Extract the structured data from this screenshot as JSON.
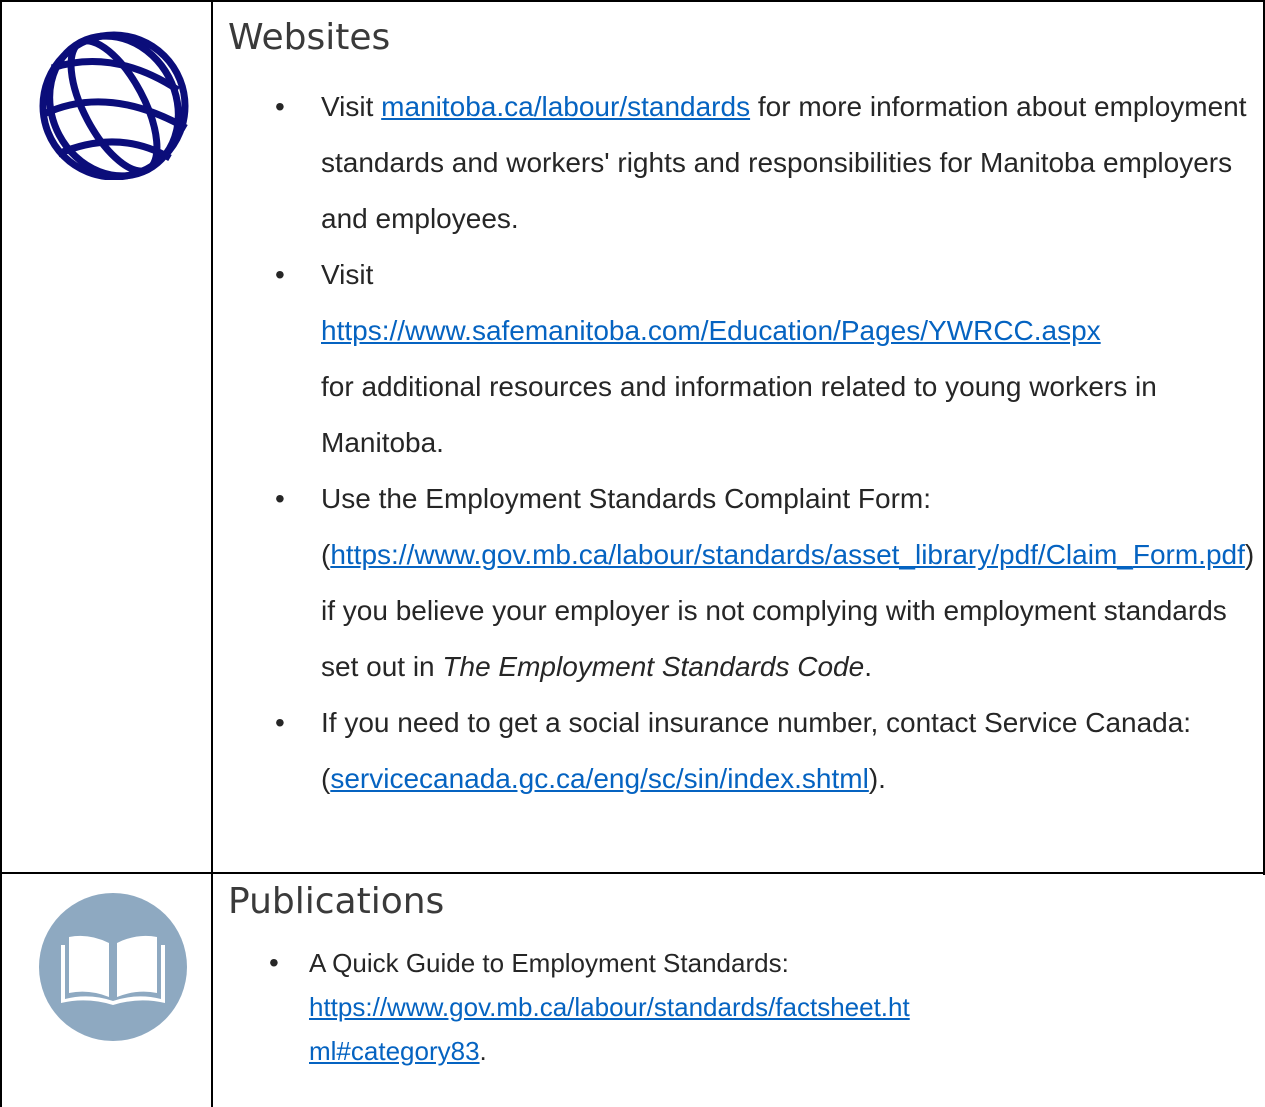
{
  "websites": {
    "title": "Websites",
    "icon": "globe-icon",
    "item1": {
      "pre": "Visit ",
      "link": "manitoba.ca/labour/standards",
      "post": " for more information about employment standards and workers' rights and responsibilities for Manitoba employers and employees."
    },
    "item2": {
      "pre": "Visit",
      "link": "https://www.safemanitoba.com/Education/Pages/YWRCC.aspx",
      "post": "for additional resources and information related to young workers in Manitoba."
    },
    "item3": {
      "pre": "Use the Employment Standards Complaint Form: (",
      "link_part1": "https://www.gov.mb.ca/labour/standards/asset_library/pdf/Claim_",
      "link_part2": "Form.pdf",
      "mid": ") if you believe your employer is not complying with employment standards set out in ",
      "italic": "The Employment Standards Code",
      "post": "."
    },
    "item4": {
      "pre": "If you need to get a social insurance number, contact Service Canada: (",
      "link": "servicecanada.gc.ca/eng/sc/sin/index.shtml",
      "post": ")."
    }
  },
  "publications": {
    "title": "Publications",
    "icon": "open-book-icon",
    "item1": {
      "pre": "A Quick Guide to Employment Standards:",
      "link_part1": "https://www.gov.mb.ca/labour/standards/factsheet.ht",
      "link_part2": "ml#category83",
      "post": "."
    }
  },
  "colors": {
    "link": "#0563c1",
    "globe": "#0b0d7a",
    "book_circle": "#8ea9c1"
  }
}
